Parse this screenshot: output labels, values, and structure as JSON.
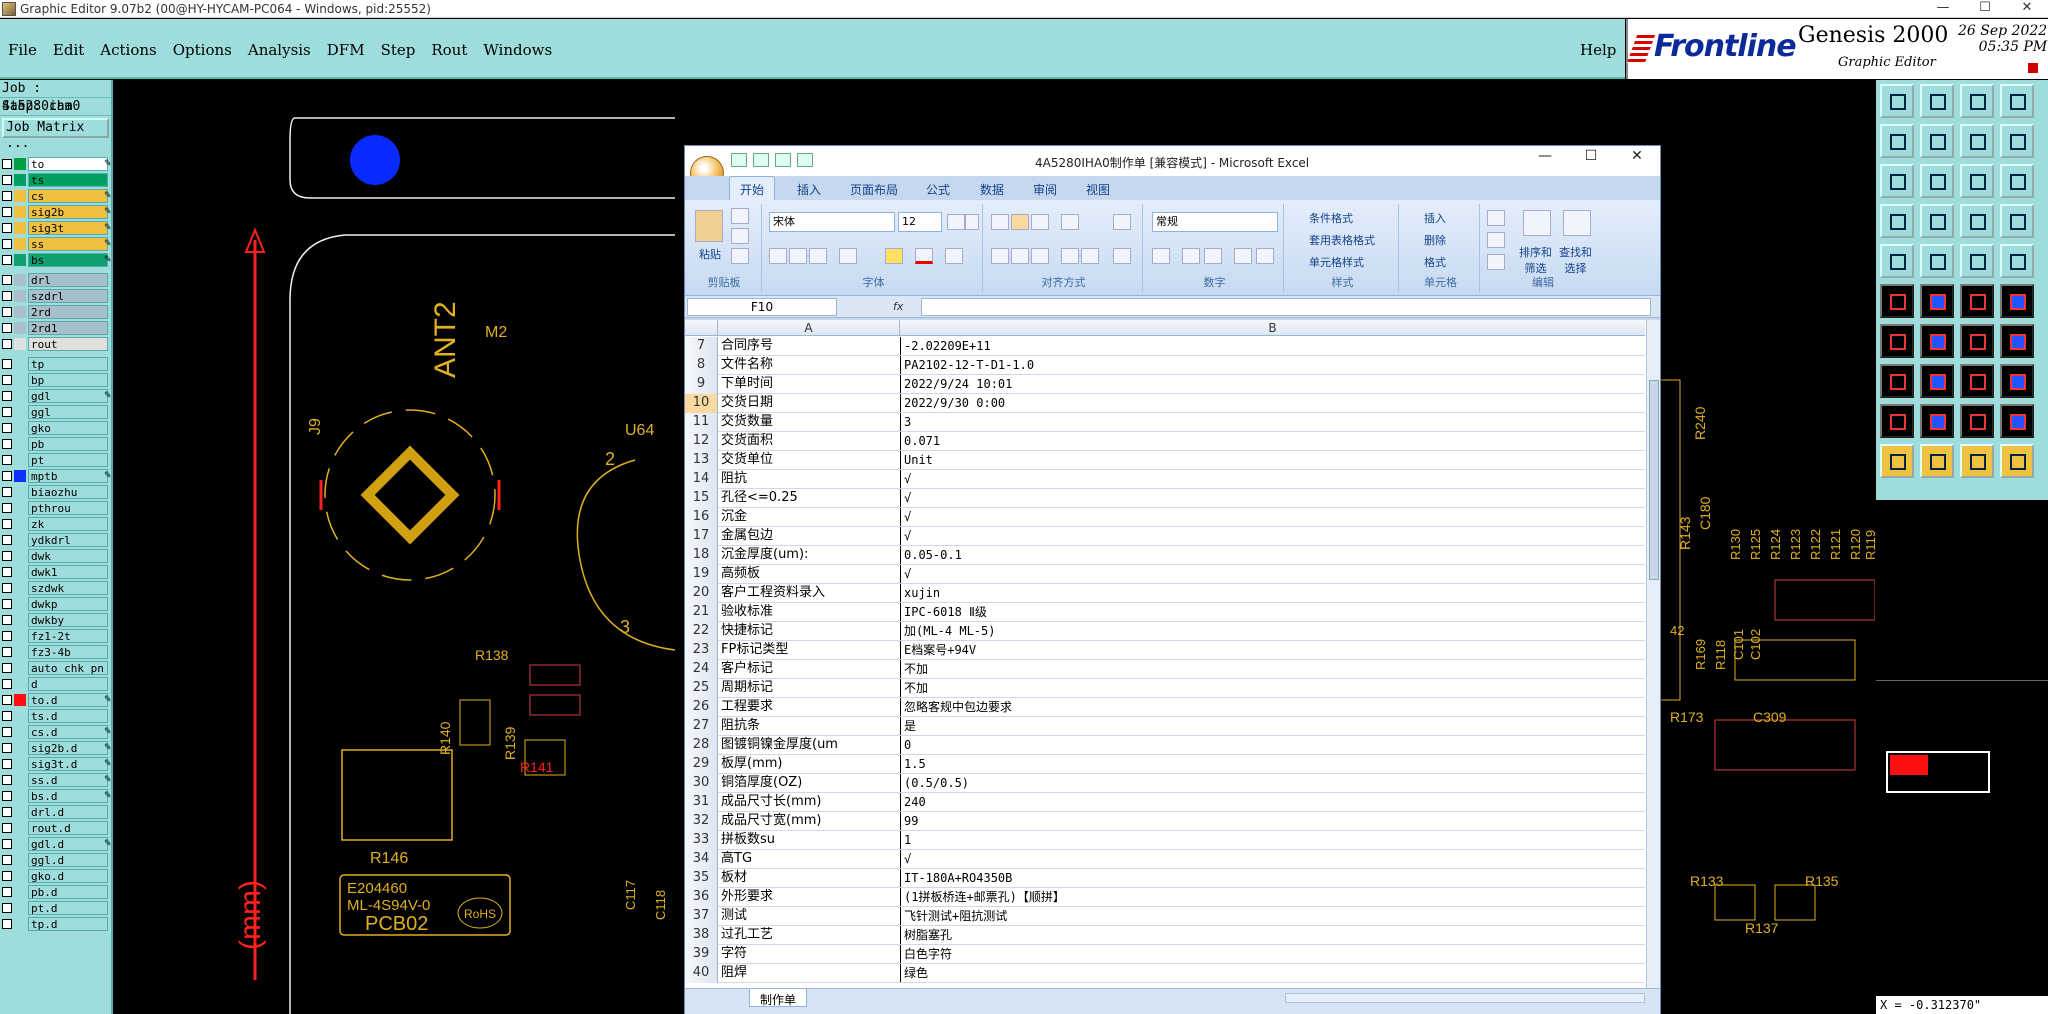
{
  "window": {
    "title": "Graphic Editor 9.07b2 (00@HY-HYCAM-PC064 - Windows, pid:25552)",
    "controls": [
      "—",
      "☐",
      "✕"
    ]
  },
  "menubar": {
    "items": [
      "File",
      "Edit",
      "Actions",
      "Options",
      "Analysis",
      "DFM",
      "Step",
      "Rout",
      "Windows"
    ],
    "help": "Help"
  },
  "brand": {
    "logo_text": "Frontline",
    "product": "Genesis 2000",
    "subtitle": "Graphic Editor",
    "date": "26 Sep 2022",
    "time": "05:35 PM"
  },
  "job": {
    "job_line": "Job : 4a5280iha0",
    "step_line": "Step: cam",
    "matrix_button": "Job Matrix ..."
  },
  "layers": [
    {
      "name": "to",
      "color": "#ffffff",
      "swatch": "#00a040",
      "edit": true
    },
    {
      "name": "ts",
      "color": "#00a060",
      "swatch": "#00a060",
      "edit": false
    },
    {
      "name": "cs",
      "color": "#f0c040",
      "swatch": "#f0c040",
      "edit": true
    },
    {
      "name": "sig2b",
      "color": "#f0c040",
      "swatch": "#f0c040",
      "edit": true
    },
    {
      "name": "sig3t",
      "color": "#f0c040",
      "swatch": "#f0c040",
      "edit": true
    },
    {
      "name": "ss",
      "color": "#f0c040",
      "swatch": "#f0c040",
      "edit": true
    },
    {
      "name": "bs",
      "color": "#10a070",
      "swatch": "#10a070",
      "edit": true
    },
    {
      "gap": true
    },
    {
      "name": "drl",
      "color": "#a8c0cc",
      "swatch": "#a8c0cc",
      "edit": false
    },
    {
      "name": "szdrl",
      "color": "#a8c0cc",
      "swatch": "#a8c0cc",
      "edit": false
    },
    {
      "name": "2rd",
      "color": "#a8c0cc",
      "swatch": "#a8c0cc",
      "edit": false
    },
    {
      "name": "2rd1",
      "color": "#a8c0cc",
      "swatch": "#a8c0cc",
      "edit": false
    },
    {
      "name": "rout",
      "color": "#e0e0e0",
      "swatch": "#e0e0e0",
      "edit": false
    },
    {
      "gap": true
    },
    {
      "name": "tp",
      "color": "#9fdcdc",
      "swatch": "#9fdcdc",
      "edit": false
    },
    {
      "name": "bp",
      "color": "#9fdcdc",
      "swatch": "#9fdcdc",
      "edit": false
    },
    {
      "name": "gdl",
      "color": "#9fdcdc",
      "swatch": "#9fdcdc",
      "edit": true
    },
    {
      "name": "ggl",
      "color": "#9fdcdc",
      "swatch": "#9fdcdc",
      "edit": false
    },
    {
      "name": "gko",
      "color": "#9fdcdc",
      "swatch": "#9fdcdc",
      "edit": false
    },
    {
      "name": "pb",
      "color": "#9fdcdc",
      "swatch": "#9fdcdc",
      "edit": false
    },
    {
      "name": "pt",
      "color": "#9fdcdc",
      "swatch": "#9fdcdc",
      "edit": false
    },
    {
      "name": "mptb",
      "color": "#9fdcdc",
      "swatch": "#1030ff",
      "edit": true
    },
    {
      "name": "biaozhu",
      "color": "#9fdcdc",
      "swatch": "#9fdcdc",
      "edit": false
    },
    {
      "name": "pthrou",
      "color": "#9fdcdc",
      "swatch": "#9fdcdc",
      "edit": false
    },
    {
      "name": "zk",
      "color": "#9fdcdc",
      "swatch": "#9fdcdc",
      "edit": false
    },
    {
      "name": "ydkdrl",
      "color": "#9fdcdc",
      "swatch": "#9fdcdc",
      "edit": false
    },
    {
      "name": "dwk",
      "color": "#9fdcdc",
      "swatch": "#9fdcdc",
      "edit": false
    },
    {
      "name": "dwk1",
      "color": "#9fdcdc",
      "swatch": "#9fdcdc",
      "edit": false
    },
    {
      "name": "szdwk",
      "color": "#9fdcdc",
      "swatch": "#9fdcdc",
      "edit": false
    },
    {
      "name": "dwkp",
      "color": "#9fdcdc",
      "swatch": "#9fdcdc",
      "edit": false
    },
    {
      "name": "dwkby",
      "color": "#9fdcdc",
      "swatch": "#9fdcdc",
      "edit": false
    },
    {
      "name": "fz1-2t",
      "color": "#9fdcdc",
      "swatch": "#9fdcdc",
      "edit": false
    },
    {
      "name": "fz3-4b",
      "color": "#9fdcdc",
      "swatch": "#9fdcdc",
      "edit": false
    },
    {
      "name": "auto_chk_pn",
      "color": "#9fdcdc",
      "swatch": "#9fdcdc",
      "edit": false
    },
    {
      "name": "d",
      "color": "#9fdcdc",
      "swatch": "#9fdcdc",
      "edit": false
    },
    {
      "name": "to.d",
      "color": "#9fdcdc",
      "swatch": "#ff1010",
      "edit": true
    },
    {
      "name": "ts.d",
      "color": "#9fdcdc",
      "swatch": "#9fdcdc",
      "edit": false
    },
    {
      "name": "cs.d",
      "color": "#9fdcdc",
      "swatch": "#9fdcdc",
      "edit": true
    },
    {
      "name": "sig2b.d",
      "color": "#9fdcdc",
      "swatch": "#9fdcdc",
      "edit": true
    },
    {
      "name": "sig3t.d",
      "color": "#9fdcdc",
      "swatch": "#9fdcdc",
      "edit": true
    },
    {
      "name": "ss.d",
      "color": "#9fdcdc",
      "swatch": "#9fdcdc",
      "edit": true
    },
    {
      "name": "bs.d",
      "color": "#9fdcdc",
      "swatch": "#9fdcdc",
      "edit": true
    },
    {
      "name": "drl.d",
      "color": "#9fdcdc",
      "swatch": "#9fdcdc",
      "edit": false
    },
    {
      "name": "rout.d",
      "color": "#9fdcdc",
      "swatch": "#9fdcdc",
      "edit": false
    },
    {
      "name": "gdl.d",
      "color": "#9fdcdc",
      "swatch": "#9fdcdc",
      "edit": true
    },
    {
      "name": "ggl.d",
      "color": "#9fdcdc",
      "swatch": "#9fdcdc",
      "edit": false
    },
    {
      "name": "gko.d",
      "color": "#9fdcdc",
      "swatch": "#9fdcdc",
      "edit": false
    },
    {
      "name": "pb.d",
      "color": "#9fdcdc",
      "swatch": "#9fdcdc",
      "edit": false
    },
    {
      "name": "pt.d",
      "color": "#9fdcdc",
      "swatch": "#9fdcdc",
      "edit": false
    },
    {
      "name": "tp.d",
      "color": "#9fdcdc",
      "swatch": "#9fdcdc",
      "edit": false
    }
  ],
  "canvas": {
    "labels": [
      "ANT2",
      "M2",
      "U64",
      "J9",
      "R138",
      "R140",
      "R139",
      "R141",
      "R146",
      "E204460",
      "ML-4S94V-0",
      "RoHS",
      "PCB02",
      "C117",
      "C118",
      "R240",
      "R143",
      "C180",
      "R130",
      "R125",
      "R124",
      "R123",
      "R122",
      "R121",
      "R120",
      "R119",
      "R169",
      "R118",
      "C101",
      "C102",
      "R173",
      "C309",
      "R133",
      "R135",
      "R137",
      "(mm)",
      "2",
      "3",
      "42"
    ]
  },
  "coords": "X = -0.312370\"",
  "excel": {
    "title": "4A5280IHA0制作单 [兼容模式] - Microsoft Excel",
    "tabs": [
      "开始",
      "插入",
      "页面布局",
      "公式",
      "数据",
      "审阅",
      "视图"
    ],
    "ribbon": {
      "paste": "粘贴",
      "clipboard": "剪贴板",
      "font_name": "宋体",
      "font_size": "12",
      "font_group": "字体",
      "align_group": "对齐方式",
      "number_format": "常规",
      "number_group": "数字",
      "cond_format": "条件格式",
      "table_format": "套用表格格式",
      "cell_style": "单元格样式",
      "style_group": "样式",
      "insert": "插入",
      "delete": "删除",
      "format": "格式",
      "cells_group": "单元格",
      "sort": "排序和\n筛选",
      "find": "查找和\n选择",
      "edit_group": "编辑"
    },
    "name_box": "F10",
    "fx": "fx",
    "col_a": "A",
    "col_b": "B",
    "rows": [
      {
        "n": "7",
        "a": "合同序号",
        "b": "-2.02209E+11"
      },
      {
        "n": "8",
        "a": "文件名称",
        "b": "PA2102-12-T-D1-1.0"
      },
      {
        "n": "9",
        "a": "下单时间",
        "b": "2022/9/24 10:01"
      },
      {
        "n": "10",
        "a": "交货日期",
        "b": "2022/9/30 0:00",
        "sel": true
      },
      {
        "n": "11",
        "a": "交货数量",
        "b": "3"
      },
      {
        "n": "12",
        "a": "交货面积",
        "b": "0.071"
      },
      {
        "n": "13",
        "a": "交货单位",
        "b": "Unit"
      },
      {
        "n": "14",
        "a": "阻抗",
        "b": "√"
      },
      {
        "n": "15",
        "a": "孔径<=0.25",
        "b": "√"
      },
      {
        "n": "16",
        "a": "沉金",
        "b": "√"
      },
      {
        "n": "17",
        "a": "金属包边",
        "b": "√"
      },
      {
        "n": "18",
        "a": "沉金厚度(um):",
        "b": "0.05-0.1"
      },
      {
        "n": "19",
        "a": "高频板",
        "b": "√"
      },
      {
        "n": "20",
        "a": "客户工程资料录入",
        "b": "xujin"
      },
      {
        "n": "21",
        "a": "验收标准",
        "b": "IPC-6018 Ⅱ级"
      },
      {
        "n": "22",
        "a": "快捷标记",
        "b": "加(ML-4 ML-5)"
      },
      {
        "n": "23",
        "a": "FP标记类型",
        "b": "E档案号+94V"
      },
      {
        "n": "24",
        "a": "客户标记",
        "b": "不加"
      },
      {
        "n": "25",
        "a": "周期标记",
        "b": "不加"
      },
      {
        "n": "26",
        "a": "工程要求",
        "b": "忽略客规中包边要求"
      },
      {
        "n": "27",
        "a": "阻抗条",
        "b": "是"
      },
      {
        "n": "28",
        "a": "图镀铜镍金厚度(um",
        "b": "0"
      },
      {
        "n": "29",
        "a": "板厚(mm)",
        "b": "1.5"
      },
      {
        "n": "30",
        "a": "铜箔厚度(OZ)",
        "b": "(0.5/0.5)"
      },
      {
        "n": "31",
        "a": "成品尺寸长(mm)",
        "b": "240"
      },
      {
        "n": "32",
        "a": "成品尺寸宽(mm)",
        "b": "99"
      },
      {
        "n": "33",
        "a": "拼板数su",
        "b": "1"
      },
      {
        "n": "34",
        "a": "高TG",
        "b": "√"
      },
      {
        "n": "35",
        "a": "板材",
        "b": "IT-180A+RO4350B"
      },
      {
        "n": "36",
        "a": "外形要求",
        "b": "(1拼板桥连+邮票孔)【顺拼】"
      },
      {
        "n": "37",
        "a": "测试",
        "b": "飞针测试+阻抗测试"
      },
      {
        "n": "38",
        "a": "过孔工艺",
        "b": "树脂塞孔"
      },
      {
        "n": "39",
        "a": "字符",
        "b": "白色字符"
      },
      {
        "n": "40",
        "a": "阻焊",
        "b": "绿色"
      }
    ],
    "sheet_tab": "制作单"
  }
}
